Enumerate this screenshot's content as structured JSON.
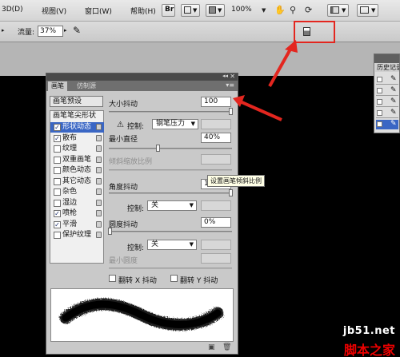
{
  "menubar": {
    "items": [
      "3D(D)",
      "视图(V)",
      "窗口(W)",
      "帮助(H)"
    ],
    "zoom": "100%"
  },
  "options_bar": {
    "flow_label": "流量:",
    "flow_value": "37%"
  },
  "history_panel": {
    "title": "历史记录"
  },
  "brush_panel": {
    "tabs": [
      "画笔",
      "仿制源"
    ],
    "presets_button": "画笔预设",
    "tip_shape_button": "画笔笔尖形状",
    "options": [
      {
        "label": "形状动态",
        "checked": true,
        "selected": true,
        "lock": true
      },
      {
        "label": "散布",
        "checked": true,
        "selected": false,
        "lock": true
      },
      {
        "label": "纹理",
        "checked": false,
        "selected": false,
        "lock": true
      },
      {
        "label": "双重画笔",
        "checked": false,
        "selected": false,
        "lock": true
      },
      {
        "label": "颜色动态",
        "checked": false,
        "selected": false,
        "lock": true
      },
      {
        "label": "其它动态",
        "checked": false,
        "selected": false,
        "lock": true
      },
      {
        "label": "杂色",
        "checked": false,
        "selected": false,
        "lock": true
      },
      {
        "label": "湿边",
        "checked": false,
        "selected": false,
        "lock": true
      },
      {
        "label": "喷枪",
        "checked": true,
        "selected": false,
        "lock": true
      },
      {
        "label": "平滑",
        "checked": true,
        "selected": false,
        "lock": true
      },
      {
        "label": "保护纹理",
        "checked": false,
        "selected": false,
        "lock": true
      }
    ],
    "size_jitter_label": "大小抖动",
    "size_jitter_value": "100",
    "control_label": "控制:",
    "control_pen_pressure": "钢笔压力",
    "min_diameter_label": "最小直径",
    "min_diameter_value": "40%",
    "tilt_scale_label": "倾斜缩放比例",
    "angle_jitter_label": "角度抖动",
    "angle_jitter_value": "10",
    "control_off_1": "关",
    "roundness_jitter_label": "圆度抖动",
    "roundness_jitter_value": "0%",
    "control_off_2": "关",
    "min_roundness_label": "最小圆度",
    "flip_x_label": "翻转 X 抖动",
    "flip_y_label": "翻转 Y 抖动"
  },
  "tooltip": "设置画笔倾斜比例",
  "watermark": {
    "line1": "jb51.net",
    "line2": "脚本之家"
  },
  "colors": {
    "annotation_red": "#e3261f",
    "selected_bg": "#3a66c4"
  }
}
